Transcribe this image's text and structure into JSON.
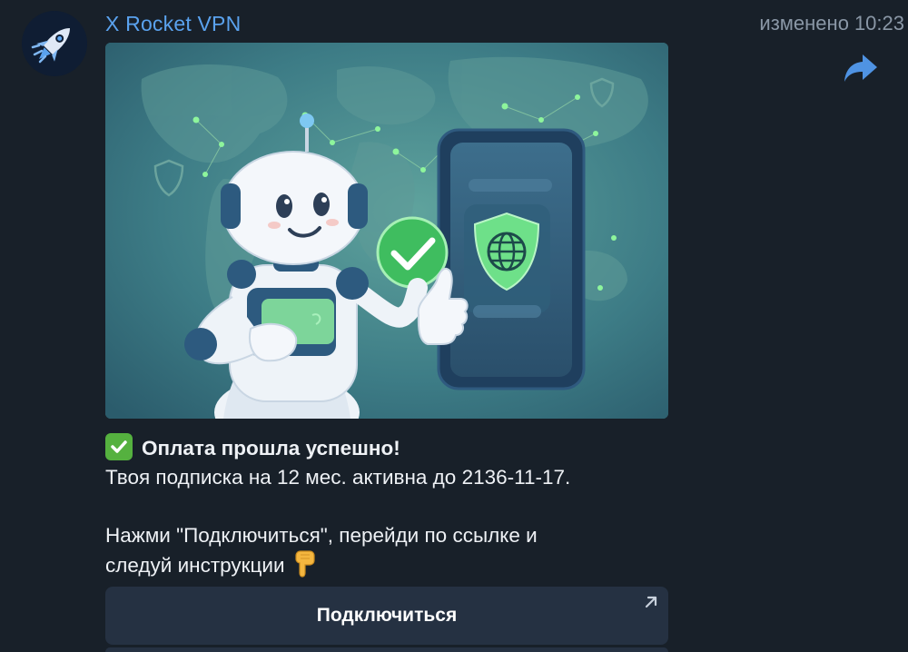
{
  "message": {
    "sender": "X Rocket VPN",
    "edited_label": "изменено",
    "time": "10:23",
    "lines": {
      "title": "Оплата прошла успешно!",
      "subscription": "Твоя подписка на 12 мес. активна до 2136-11-17.",
      "instruction_1": "Нажми \"Подключиться\", перейди по ссылке и",
      "instruction_2": "следуй инструкции"
    },
    "image": {
      "subject": "robot-thumbs-up-with-vpn-phone"
    }
  },
  "buttons": {
    "connect_label": "Подключиться"
  },
  "icons": {
    "avatar": "rocket-icon",
    "forward": "forward-arrow-icon",
    "title_emoji": "check-mark-emoji",
    "instruction_emoji": "pointing-down-emoji",
    "button_link": "external-link-arrow-icon"
  },
  "colors": {
    "background": "#182029",
    "sender_name": "#5aa2ee",
    "button_bg": "#253142",
    "meta_text": "#8a97a6"
  }
}
